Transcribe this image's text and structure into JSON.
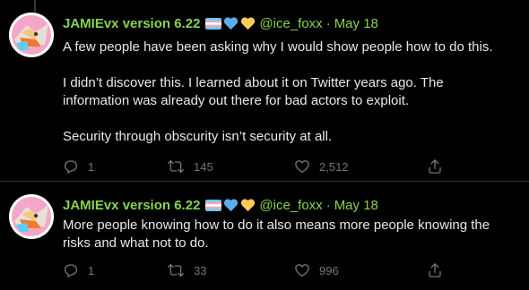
{
  "tweets": [
    {
      "author_name": "JAMIEvx version 6.22",
      "handle": "@ice_foxx",
      "separator": "·",
      "date": "May 18",
      "paragraphs": [
        "A few people have been asking why I would show people how to do this.",
        "I didn’t discover this. I learned about it on Twitter years ago. The information was already out there for bad actors to exploit.",
        "Security through obscurity isn’t security at all."
      ],
      "replies": "1",
      "retweets": "145",
      "likes": "2,512"
    },
    {
      "author_name": "JAMIEvx version 6.22",
      "handle": "@ice_foxx",
      "separator": "·",
      "date": "May 18",
      "paragraphs": [
        "More people knowing how to do it also means more people knowing the risks and what not to do."
      ],
      "replies": "1",
      "retweets": "33",
      "likes": "996"
    }
  ],
  "name_badges": [
    "trans-flag-icon",
    "blue-heart-icon",
    "yellow-heart-icon"
  ],
  "colors": {
    "background": "#000000",
    "name": "#87d34c",
    "text": "#e7e9ea",
    "muted": "#71767b",
    "divider": "#2f3336"
  },
  "icons": [
    "reply-icon",
    "retweet-icon",
    "like-icon",
    "share-icon",
    "more-icon"
  ]
}
